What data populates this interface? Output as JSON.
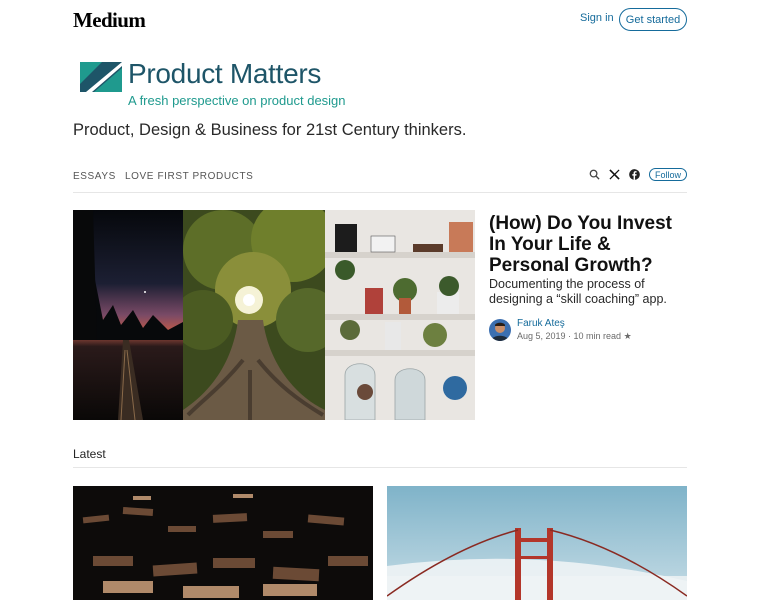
{
  "header": {
    "brand": "Medium",
    "sign_in": "Sign in",
    "get_started": "Get started"
  },
  "publication": {
    "name": "Product Matters",
    "tagline_logo": "A fresh perspective on product design",
    "description": "Product, Design & Business for 21st Century thinkers."
  },
  "nav": {
    "items": [
      "ESSAYS",
      "LOVE FIRST PRODUCTS"
    ],
    "follow": "Follow",
    "icons": [
      "search-icon",
      "x-icon",
      "facebook-icon"
    ]
  },
  "featured": {
    "title": "(How) Do You Invest In Your Life & Personal Growth?",
    "subtitle": "Documenting the process of designing a “skill coaching” app.",
    "author": "Faruk Ateş",
    "meta": "Aug 5, 2019 · 10 min read ★"
  },
  "latest": {
    "heading": "Latest"
  },
  "colors": {
    "accent": "#156b9b",
    "brand_teal": "#1f9a8e",
    "brand_navy": "#1e5568"
  }
}
